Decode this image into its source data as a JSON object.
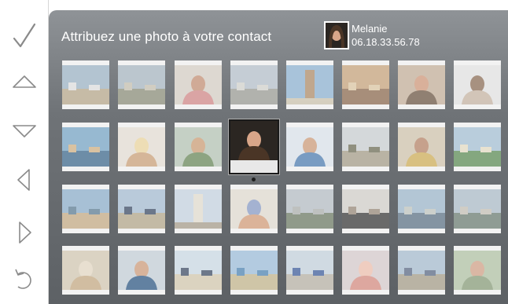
{
  "prompt": "Attribuez une photo à votre contact",
  "contact": {
    "name": "Melanie",
    "phone": "06.18.33.56.78"
  },
  "rail": [
    {
      "name": "confirm-check-icon",
      "icon": "check"
    },
    {
      "name": "up-arrow-icon",
      "icon": "up"
    },
    {
      "name": "down-arrow-icon",
      "icon": "down"
    },
    {
      "name": "left-arrow-icon",
      "icon": "left"
    },
    {
      "name": "right-arrow-icon",
      "icon": "right"
    },
    {
      "name": "back-icon",
      "icon": "back"
    }
  ],
  "grid": {
    "rows": 4,
    "cols": 8,
    "selected_index": 11,
    "photos": [
      {
        "subject": "beach-town",
        "sky": "#9fb6c8",
        "ground": "#b9a98c",
        "accent": "#e2e2e2"
      },
      {
        "subject": "harbor",
        "sky": "#a9b9c4",
        "ground": "#8d8f7b",
        "accent": "#c8c2b2"
      },
      {
        "subject": "child-portrait",
        "sky": "#d9d2c8",
        "ground": "#d58a8a",
        "accent": "#c79276"
      },
      {
        "subject": "city-street",
        "sky": "#b7c3cd",
        "ground": "#9b9d96",
        "accent": "#d6d6d0"
      },
      {
        "subject": "monument",
        "sky": "#8fb4d4",
        "ground": "#cfc6b0",
        "accent": "#b08e6a"
      },
      {
        "subject": "painting",
        "sky": "#c9a57d",
        "ground": "#8e6b50",
        "accent": "#e0c9a6"
      },
      {
        "subject": "woman-portrait",
        "sky": "#c7b29c",
        "ground": "#6e5845",
        "accent": "#d39a7c"
      },
      {
        "subject": "man-portrait",
        "sky": "#e6e6e6",
        "ground": "#c9b7a6",
        "accent": "#8e6f58"
      },
      {
        "subject": "surfer",
        "sky": "#79a8c9",
        "ground": "#3f6b8f",
        "accent": "#d4b487"
      },
      {
        "subject": "blonde-child",
        "sky": "#e9e2d8",
        "ground": "#cfa47c",
        "accent": "#f0d9a2"
      },
      {
        "subject": "boy-outdoor",
        "sky": "#b8c7b8",
        "ground": "#6b8a5c",
        "accent": "#d0a178"
      },
      {
        "subject": "melanie",
        "sky": "#2b2622",
        "ground": "#4a3526",
        "accent": "#d9a689"
      },
      {
        "subject": "child-blue",
        "sky": "#dfe7ef",
        "ground": "#4f7fb4",
        "accent": "#d19f7d"
      },
      {
        "subject": "tree-scene",
        "sky": "#cdd3d6",
        "ground": "#a7a08a",
        "accent": "#6f6f58"
      },
      {
        "subject": "boy-yellow",
        "sky": "#d4c8b0",
        "ground": "#d2b15a",
        "accent": "#b9866a"
      },
      {
        "subject": "flowers",
        "sky": "#a8c3d8",
        "ground": "#5f8f57",
        "accent": "#e8e0c8"
      },
      {
        "subject": "beach-group",
        "sky": "#8fb2cf",
        "ground": "#c7ad86",
        "accent": "#5d7e96"
      },
      {
        "subject": "family-walk",
        "sky": "#a7bfd6",
        "ground": "#b5a98c",
        "accent": "#3c4c66"
      },
      {
        "subject": "leaning-tower",
        "sky": "#c9d7e4",
        "ground": "#a9a08e",
        "accent": "#e6e0d2"
      },
      {
        "subject": "toddler",
        "sky": "#e5dfd4",
        "ground": "#d7a07c",
        "accent": "#8b9ec9"
      },
      {
        "subject": "landscape",
        "sky": "#b8c1c8",
        "ground": "#6f7d66",
        "accent": "#aeb3b0"
      },
      {
        "subject": "dark-figure",
        "sky": "#d6d3cd",
        "ground": "#3a3a3a",
        "accent": "#9a8a7a"
      },
      {
        "subject": "lake",
        "sky": "#9fb9cf",
        "ground": "#5e7488",
        "accent": "#c2c8c2"
      },
      {
        "subject": "coast",
        "sky": "#aebfcc",
        "ground": "#6d7f74",
        "accent": "#c8c4b8"
      },
      {
        "subject": "sand-child",
        "sky": "#d7cbb6",
        "ground": "#c9ad86",
        "accent": "#e8dcc8"
      },
      {
        "subject": "man-smile",
        "sky": "#c7d2db",
        "ground": "#2f5a86",
        "accent": "#d1a07e"
      },
      {
        "subject": "beach-people",
        "sky": "#cfdde8",
        "ground": "#d7cbb1",
        "accent": "#3f4e66"
      },
      {
        "subject": "sea-coast",
        "sky": "#9fc0dd",
        "ground": "#c6b88f",
        "accent": "#4f86b5"
      },
      {
        "subject": "cyclist",
        "sky": "#c7d6e1",
        "ground": "#b9b4a7",
        "accent": "#3f5f9e"
      },
      {
        "subject": "pink-hat",
        "sky": "#d9cfd0",
        "ground": "#d98f84",
        "accent": "#f2c3b1"
      },
      {
        "subject": "tourists",
        "sky": "#a9bfd2",
        "ground": "#a89f8a",
        "accent": "#5b6b86"
      },
      {
        "subject": "green-portrait",
        "sky": "#b4c6a8",
        "ground": "#8aa07c",
        "accent": "#d6a58a"
      }
    ]
  }
}
